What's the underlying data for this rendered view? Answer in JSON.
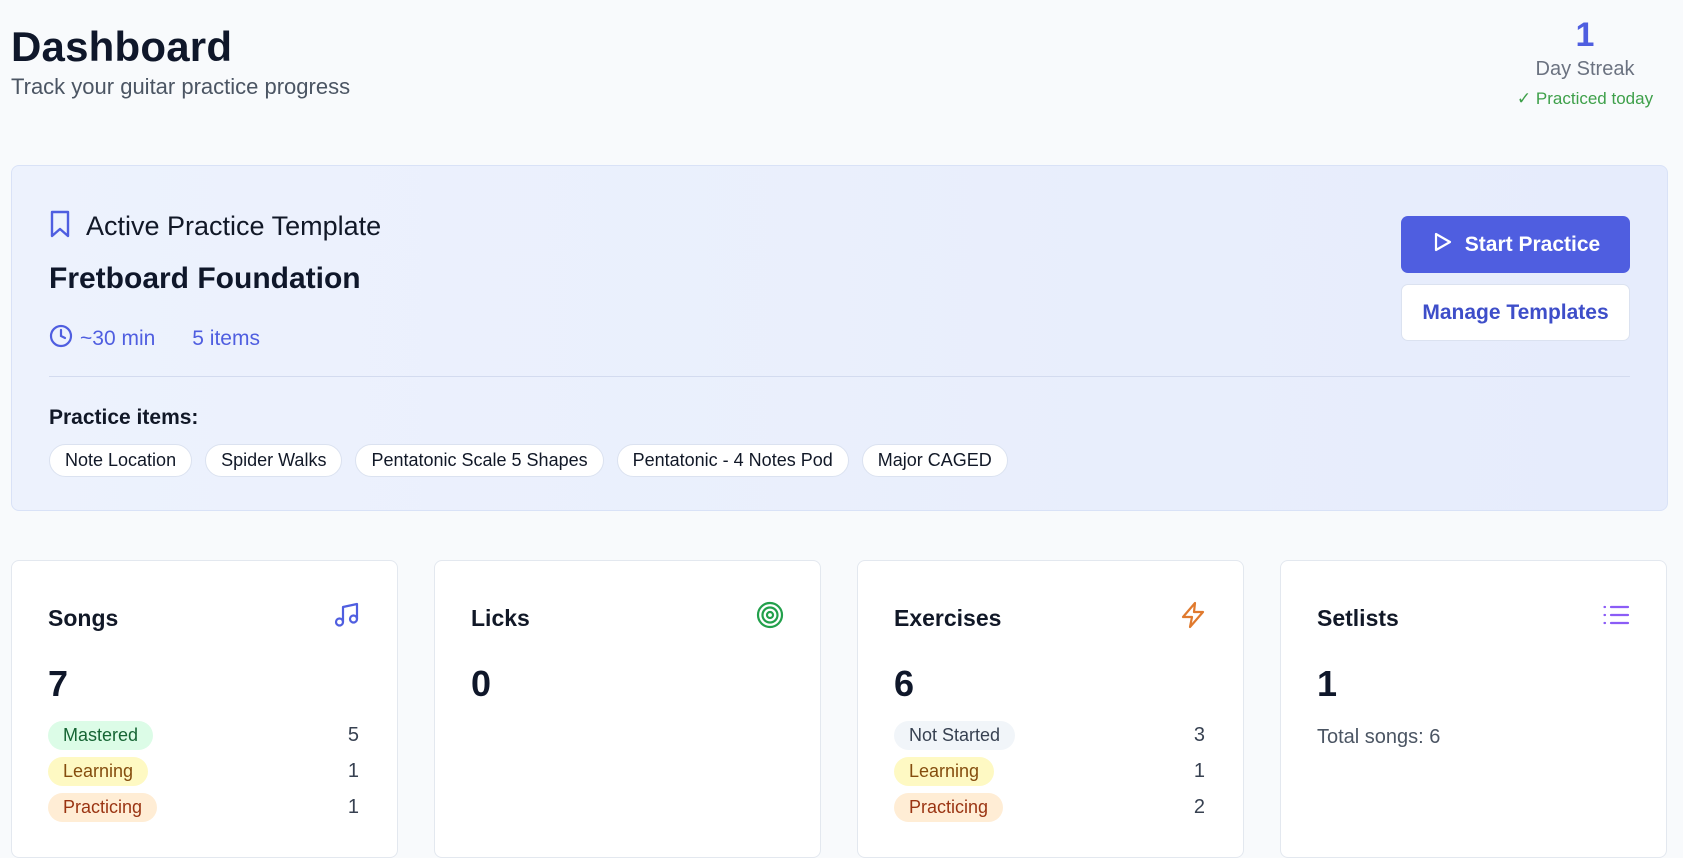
{
  "header": {
    "title": "Dashboard",
    "subtitle": "Track your guitar practice progress"
  },
  "streak": {
    "count": "1",
    "label": "Day Streak",
    "status": "✓ Practiced today"
  },
  "template": {
    "heading": "Active Practice Template",
    "name": "Fretboard Foundation",
    "duration": "~30 min",
    "items_count": "5 items",
    "items_label": "Practice items:",
    "items": [
      "Note Location",
      "Spider Walks",
      "Pentatonic Scale 5 Shapes",
      "Pentatonic - 4 Notes Pod",
      "Major CAGED"
    ],
    "start_button": "Start Practice",
    "manage_button": "Manage Templates",
    "icons": {
      "heading": "bookmark-icon",
      "duration": "clock-icon",
      "start": "play-icon"
    }
  },
  "stats": {
    "songs": {
      "title": "Songs",
      "value": "7",
      "icon": "music-note-icon",
      "icon_color": "#4f5ee0",
      "rows": [
        {
          "label": "Mastered",
          "count": "5"
        },
        {
          "label": "Learning",
          "count": "1"
        },
        {
          "label": "Practicing",
          "count": "1"
        }
      ]
    },
    "licks": {
      "title": "Licks",
      "value": "0",
      "icon": "target-icon",
      "icon_color": "#22a04b"
    },
    "exercises": {
      "title": "Exercises",
      "value": "6",
      "icon": "lightning-icon",
      "icon_color": "#e07a2e",
      "rows": [
        {
          "label": "Not Started",
          "count": "3"
        },
        {
          "label": "Learning",
          "count": "1"
        },
        {
          "label": "Practicing",
          "count": "2"
        }
      ]
    },
    "setlists": {
      "title": "Setlists",
      "value": "1",
      "icon": "list-icon",
      "icon_color": "#8b5cf6",
      "total": "Total songs: 6"
    }
  },
  "colors": {
    "accent": "#4f5ee0",
    "success": "#3ea04a",
    "mastered_bg": "#dcfce7",
    "learning_bg": "#fef9c3",
    "practicing_bg": "#ffedd5",
    "not_started_bg": "#f1f5f9"
  }
}
